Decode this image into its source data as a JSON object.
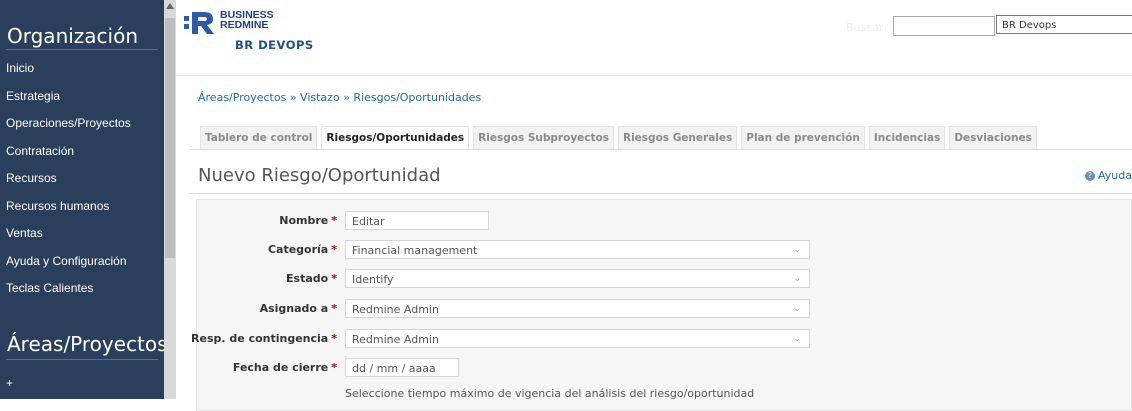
{
  "sidebar": {
    "org_heading": "Organización",
    "items": [
      {
        "label": "Inicio"
      },
      {
        "label": "Estrategia"
      },
      {
        "label": "Operaciones/Proyectos"
      },
      {
        "label": "Contratación"
      },
      {
        "label": "Recursos"
      },
      {
        "label": "Recursos humanos"
      },
      {
        "label": "Ventas"
      },
      {
        "label": "Ayuda y Configuración"
      },
      {
        "label": "Teclas Calientes"
      }
    ],
    "areas_heading": "Áreas/Proyectos",
    "add_label": "+"
  },
  "header": {
    "logo_line1": "BUSINESS",
    "logo_line2": "REDMINE",
    "project_name": "BR DEVOPS",
    "search_label": "Buscar:",
    "jump_value": "BR Devops"
  },
  "breadcrumb": {
    "items": [
      "Áreas/Proyectos",
      "Vistazo",
      "Riesgos/Oportunidades"
    ],
    "separator": "»"
  },
  "tabs": [
    {
      "label": "Tablero de control",
      "selected": false
    },
    {
      "label": "Riesgos/Oportunidades",
      "selected": true
    },
    {
      "label": "Riesgos Subproyectos",
      "selected": false
    },
    {
      "label": "Riesgos Generales",
      "selected": false
    },
    {
      "label": "Plan de prevención",
      "selected": false
    },
    {
      "label": "Incidencias",
      "selected": false
    },
    {
      "label": "Desviaciones",
      "selected": false
    }
  ],
  "page": {
    "title": "Nuevo Riesgo/Oportunidad",
    "help_label": "Ayuda"
  },
  "form": {
    "required_mark": "*",
    "nombre": {
      "label": "Nombre",
      "value": "Editar"
    },
    "categoria": {
      "label": "Categoría",
      "value": "Financial management"
    },
    "estado": {
      "label": "Estado",
      "value": "Identify"
    },
    "asignado": {
      "label": "Asignado a",
      "value": "Redmine Admin"
    },
    "contingencia": {
      "label": "Resp. de contingencia",
      "value": "Redmine Admin"
    },
    "fecha": {
      "label": "Fecha de cierre",
      "placeholder": "dd / mm / aaaa"
    },
    "fecha_hint": "Seleccione tiempo máximo de vigencia del análisis del riesgo/oportunidad"
  },
  "colors": {
    "sidebar_bg": "#2a3f5c",
    "link": "#1a6aa8",
    "brand": "#1f3f8e",
    "required": "#bb0000"
  }
}
